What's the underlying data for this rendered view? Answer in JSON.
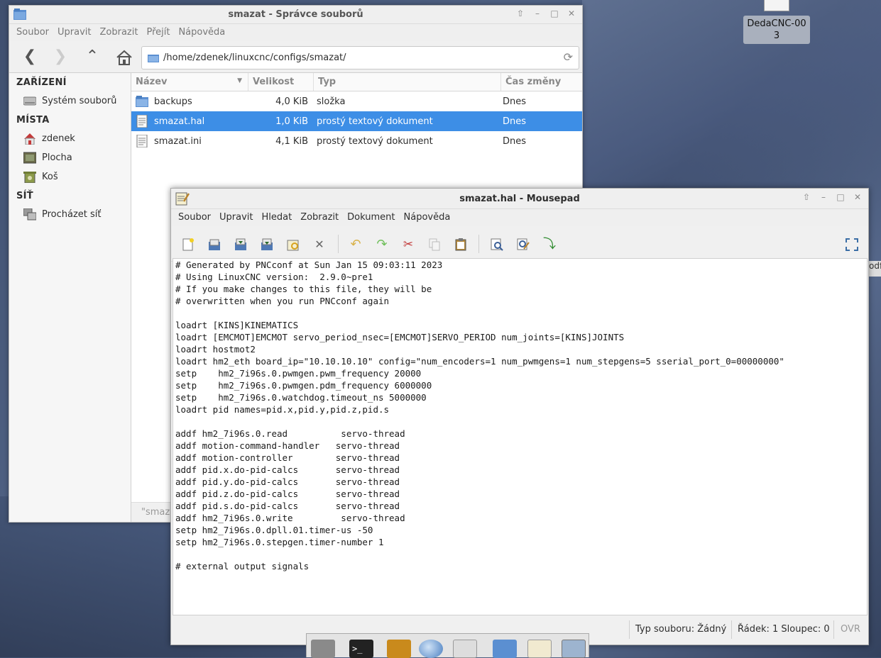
{
  "desktop": {
    "icon_label": "DedaCNC-00 3"
  },
  "file_manager": {
    "title": "smazat - Správce souborů",
    "menu": [
      "Soubor",
      "Upravit",
      "Zobrazit",
      "Přejít",
      "Nápověda"
    ],
    "path": "/home/zdenek/linuxcnc/configs/smazat/",
    "sidebar": {
      "devices_header": "ZAŘÍZENÍ",
      "devices": [
        {
          "label": "Systém souborů",
          "icon": "drive-icon"
        }
      ],
      "places_header": "MÍSTA",
      "places": [
        {
          "label": "zdenek",
          "icon": "home-icon"
        },
        {
          "label": "Plocha",
          "icon": "desktop-icon"
        },
        {
          "label": "Koš",
          "icon": "trash-icon"
        }
      ],
      "network_header": "SÍŤ",
      "network": [
        {
          "label": "Procházet síť",
          "icon": "network-icon"
        }
      ]
    },
    "columns": [
      "Název",
      "Velikost",
      "Typ",
      "Čas změny"
    ],
    "rows": [
      {
        "name": "backups",
        "size": "4,0 KiB",
        "type": "složka",
        "modified": "Dnes",
        "icon": "folder-icon",
        "selected": false
      },
      {
        "name": "smazat.hal",
        "size": "1,0 KiB",
        "type": "prostý textový dokument",
        "modified": "Dnes",
        "icon": "text-file-icon",
        "selected": true
      },
      {
        "name": "smazat.ini",
        "size": "4,1 KiB",
        "type": "prostý textový dokument",
        "modified": "Dnes",
        "icon": "text-file-icon",
        "selected": false
      }
    ],
    "status_text": "\"smaz"
  },
  "mousepad": {
    "title": "smazat.hal - Mousepad",
    "menu": [
      "Soubor",
      "Upravit",
      "Hledat",
      "Zobrazit",
      "Dokument",
      "Nápověda"
    ],
    "content": "# Generated by PNCconf at Sun Jan 15 09:03:11 2023\n# Using LinuxCNC version:  2.9.0~pre1\n# If you make changes to this file, they will be\n# overwritten when you run PNCconf again\n\nloadrt [KINS]KINEMATICS\nloadrt [EMCMOT]EMCMOT servo_period_nsec=[EMCMOT]SERVO_PERIOD num_joints=[KINS]JOINTS\nloadrt hostmot2\nloadrt hm2_eth board_ip=\"10.10.10.10\" config=\"num_encoders=1 num_pwmgens=1 num_stepgens=5 sserial_port_0=00000000\"\nsetp    hm2_7i96s.0.pwmgen.pwm_frequency 20000\nsetp    hm2_7i96s.0.pwmgen.pdm_frequency 6000000\nsetp    hm2_7i96s.0.watchdog.timeout_ns 5000000\nloadrt pid names=pid.x,pid.y,pid.z,pid.s\n\naddf hm2_7i96s.0.read          servo-thread\naddf motion-command-handler   servo-thread\naddf motion-controller        servo-thread\naddf pid.x.do-pid-calcs       servo-thread\naddf pid.y.do-pid-calcs       servo-thread\naddf pid.z.do-pid-calcs       servo-thread\naddf pid.s.do-pid-calcs       servo-thread\naddf hm2_7i96s.0.write         servo-thread\nsetp hm2_7i96s.0.dpll.01.timer-us -50\nsetp hm2_7i96s.0.stepgen.timer-number 1\n\n# external output signals",
    "status": {
      "filetype": "Typ souboru: Žádný",
      "position": "Řádek: 1 Sloupec: 0",
      "mode": "OVR"
    }
  },
  "side_tab_text": "odf"
}
